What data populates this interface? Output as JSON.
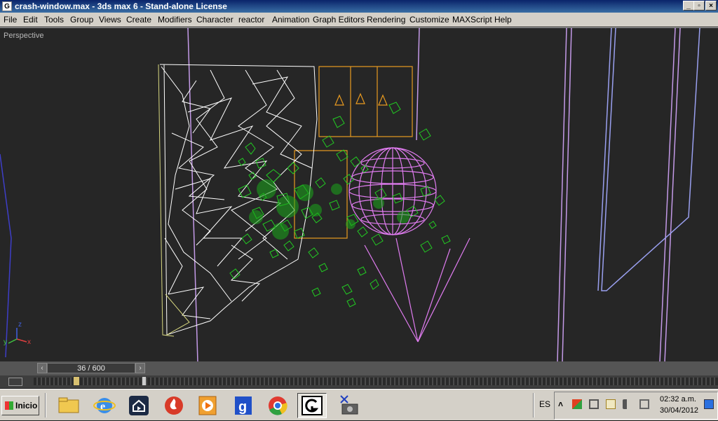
{
  "window": {
    "title": "crash-window.max - 3ds max 6 - Stand-alone License",
    "app_icon": "3ds-max-app-icon",
    "controls": {
      "minimize": "_",
      "maximize": "▫",
      "close": "×"
    }
  },
  "menubar": {
    "items": [
      "File",
      "Edit",
      "Tools",
      "Group",
      "Views",
      "Create",
      "Modifiers",
      "Character",
      "reactor",
      "Animation",
      "Graph Editors",
      "Rendering",
      "Customize",
      "MAXScript",
      "Help"
    ]
  },
  "viewport": {
    "label": "Perspective",
    "axis": {
      "x": "x",
      "y": "y",
      "z": "z"
    },
    "colors": {
      "background": "#262626",
      "shards": "#ffffff",
      "debris": "#22cc22",
      "frame": "#e89a20",
      "sphere": "#e07cf0",
      "walls": "#c49ae8"
    }
  },
  "timeslider": {
    "frame_display": "36 / 600",
    "prev_icon": "‹",
    "next_icon": "›",
    "current_frame": 36,
    "total_frames": 600
  },
  "taskbar": {
    "start_label": "Inicio",
    "quick_launch": [
      "explorer-folder-icon",
      "internet-explorer-icon",
      "media-center-icon",
      "fire-app-icon",
      "media-player-icon",
      "google-g-icon",
      "chrome-icon",
      "3ds-max-icon",
      "render-tool-icon"
    ],
    "language": "ES",
    "clock": {
      "time": "02:32 a.m.",
      "date": "30/04/2012"
    },
    "tray_icons": [
      "expand-tray-icon",
      "network-icon",
      "safely-remove-icon",
      "action-center-icon",
      "volume-icon",
      "battery-icon",
      "screen-icon"
    ]
  }
}
